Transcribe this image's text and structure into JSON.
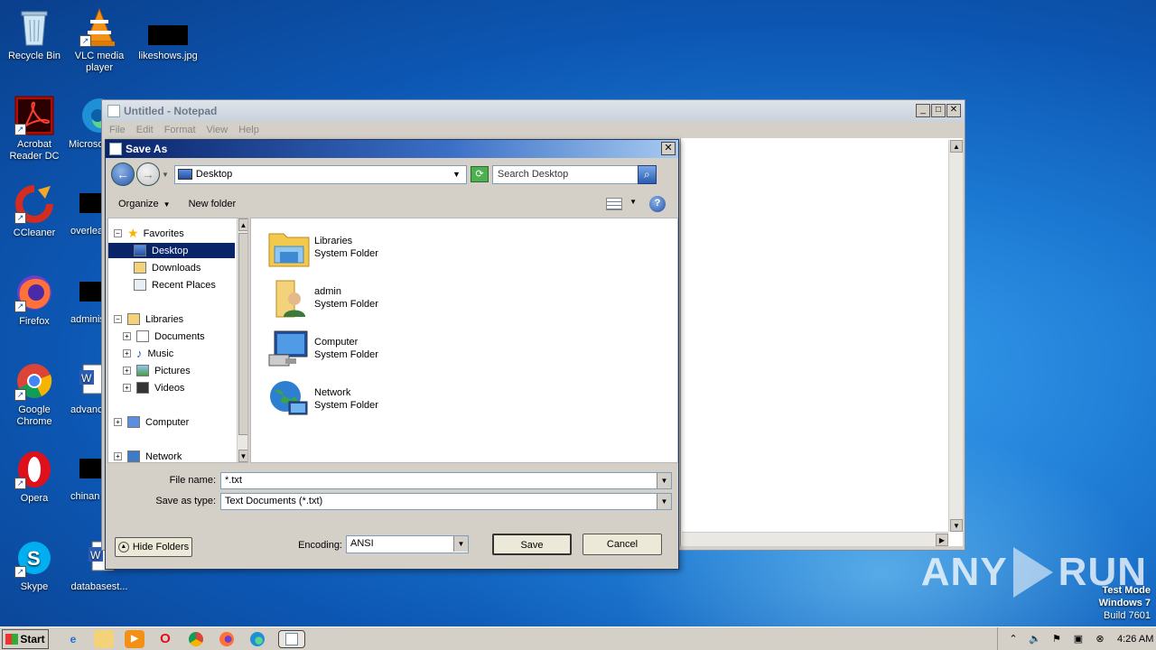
{
  "desktop": {
    "icons": [
      {
        "label": "Recycle Bin"
      },
      {
        "label": "VLC media player"
      },
      {
        "label": "likeshows.jpg"
      },
      {
        "label": "Acrobat Reader DC"
      },
      {
        "label": "Microso"
      },
      {
        "label": "CCleaner"
      },
      {
        "label": "overlea"
      },
      {
        "label": "Firefox"
      },
      {
        "label": "adminis"
      },
      {
        "label": "Google Chrome"
      },
      {
        "label": "advanc"
      },
      {
        "label": "Opera"
      },
      {
        "label": "chinan"
      },
      {
        "label": "Skype"
      },
      {
        "label": "databasest..."
      }
    ]
  },
  "notepad": {
    "title": "Untitled - Notepad",
    "menu": [
      "File",
      "Edit",
      "Format",
      "View",
      "Help"
    ]
  },
  "dialog": {
    "title": "Save As",
    "address": "Desktop",
    "search_placeholder": "Search Desktop",
    "organize": "Organize",
    "new_folder": "New folder",
    "tree": {
      "favorites": "Favorites",
      "desktop": "Desktop",
      "downloads": "Downloads",
      "recent": "Recent Places",
      "libraries": "Libraries",
      "documents": "Documents",
      "music": "Music",
      "pictures": "Pictures",
      "videos": "Videos",
      "computer": "Computer",
      "network": "Network"
    },
    "files": [
      {
        "name": "Libraries",
        "type": "System Folder"
      },
      {
        "name": "admin",
        "type": "System Folder"
      },
      {
        "name": "Computer",
        "type": "System Folder"
      },
      {
        "name": "Network",
        "type": "System Folder"
      }
    ],
    "file_name_label": "File name:",
    "file_name_value": "*.txt",
    "save_type_label": "Save as type:",
    "save_type_value": "Text Documents (*.txt)",
    "encoding_label": "Encoding:",
    "encoding_value": "ANSI",
    "save": "Save",
    "cancel": "Cancel",
    "hide_folders": "Hide Folders"
  },
  "taskbar": {
    "start": "Start",
    "clock": "4:26 AM"
  },
  "watermark": {
    "left": "ANY",
    "right": "RUN"
  },
  "test_mode": {
    "line1": "Test Mode",
    "line2": "Windows 7",
    "line3": "Build 7601"
  }
}
